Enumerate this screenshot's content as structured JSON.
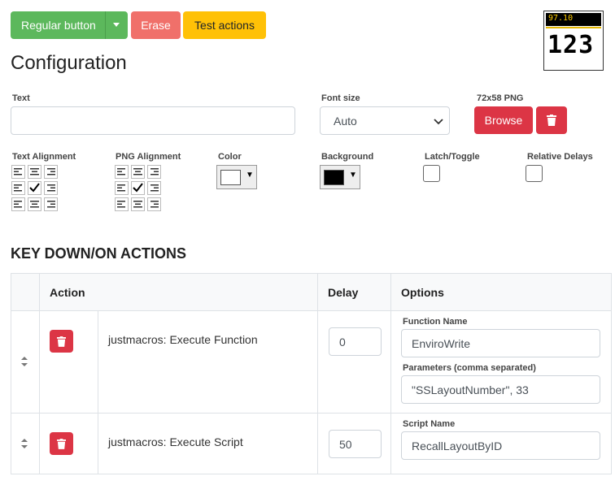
{
  "toolbar": {
    "regular_button": "Regular button",
    "erase_button": "Erase",
    "test_actions_button": "Test actions"
  },
  "preview": {
    "top_text": "97.10",
    "main_text": "123"
  },
  "page_title": "Configuration",
  "form": {
    "text_label": "Text",
    "text_value": "",
    "font_size_label": "Font size",
    "font_size_value": "Auto",
    "png_label": "72x58 PNG",
    "browse_button": "Browse",
    "text_alignment_label": "Text Alignment",
    "png_alignment_label": "PNG Alignment",
    "color_label": "Color",
    "color_value": "#ffffff",
    "background_label": "Background",
    "background_value": "#000000",
    "latch_label": "Latch/Toggle",
    "relative_delays_label": "Relative Delays"
  },
  "actions_heading": "KEY DOWN/ON ACTIONS",
  "table": {
    "headers": {
      "action": "Action",
      "delay": "Delay",
      "options": "Options"
    },
    "rows": [
      {
        "action": "justmacros: Execute Function",
        "delay": "0",
        "options": [
          {
            "label": "Function Name",
            "value": "EnviroWrite"
          },
          {
            "label": "Parameters (comma separated)",
            "value": "\"SSLayoutNumber\", 33"
          }
        ]
      },
      {
        "action": "justmacros: Execute Script",
        "delay": "50",
        "options": [
          {
            "label": "Script Name",
            "value": "RecallLayoutByID"
          }
        ]
      }
    ]
  },
  "colors": {
    "green": "#5cb85c",
    "red_erase": "#f0706a",
    "yellow": "#ffc107",
    "danger": "#dc3545"
  }
}
